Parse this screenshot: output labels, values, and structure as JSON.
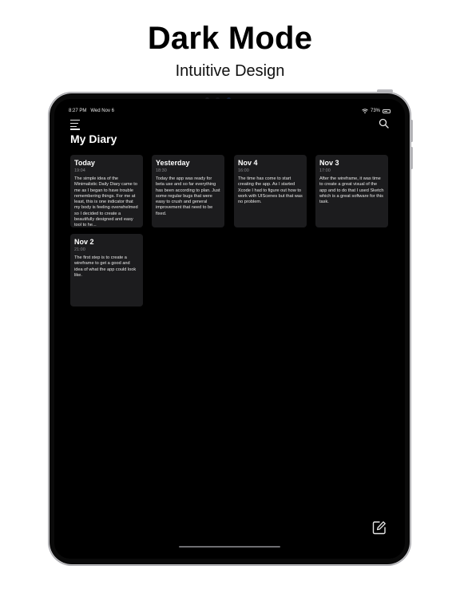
{
  "promo": {
    "title": "Dark Mode",
    "subtitle": "Intuitive Design"
  },
  "status_bar": {
    "time": "8:27 PM",
    "date": "Wed Nov 6",
    "battery": "73%",
    "battery_level": 0.73
  },
  "header": {
    "title": "My Diary",
    "menu_icon": "menu-icon",
    "search_icon": "search-icon"
  },
  "entries": [
    {
      "title": "Today",
      "time": "19:04",
      "text": "The simple idea of the Minimalistic Daily Diary came to me as I began to have trouble remembering things. For me at least, this is one indicator that my body is feeling overwhelmed so I decided to create a beautifully designed and easy tool to he..."
    },
    {
      "title": "Yesterday",
      "time": "18:30",
      "text": "Today the app was ready for beta use and so far everything has been according to plan. Just some regular bugs that were easy to crush and general improvement that need to be fixed."
    },
    {
      "title": "Nov 4",
      "time": "16:00",
      "text": "The time has come to start creating the app. As I started Xcode I had to figure out how to work with UIScenes but that was no problem."
    },
    {
      "title": "Nov 3",
      "time": "17:00",
      "text": "After the wireframe, it was time to create a great visual of the app and to do that I used Sketch which is a great software for this task."
    },
    {
      "title": "Nov 2",
      "time": "21:00",
      "text": "The first step is to create a wireframe to get a good and idea of what the app could look like."
    }
  ],
  "toolbar": {
    "compose_icon": "compose-icon"
  },
  "colors": {
    "background": "#000000",
    "card": "#1c1c1e",
    "text_primary": "#ffffff",
    "text_secondary": "#8a8a8e"
  }
}
